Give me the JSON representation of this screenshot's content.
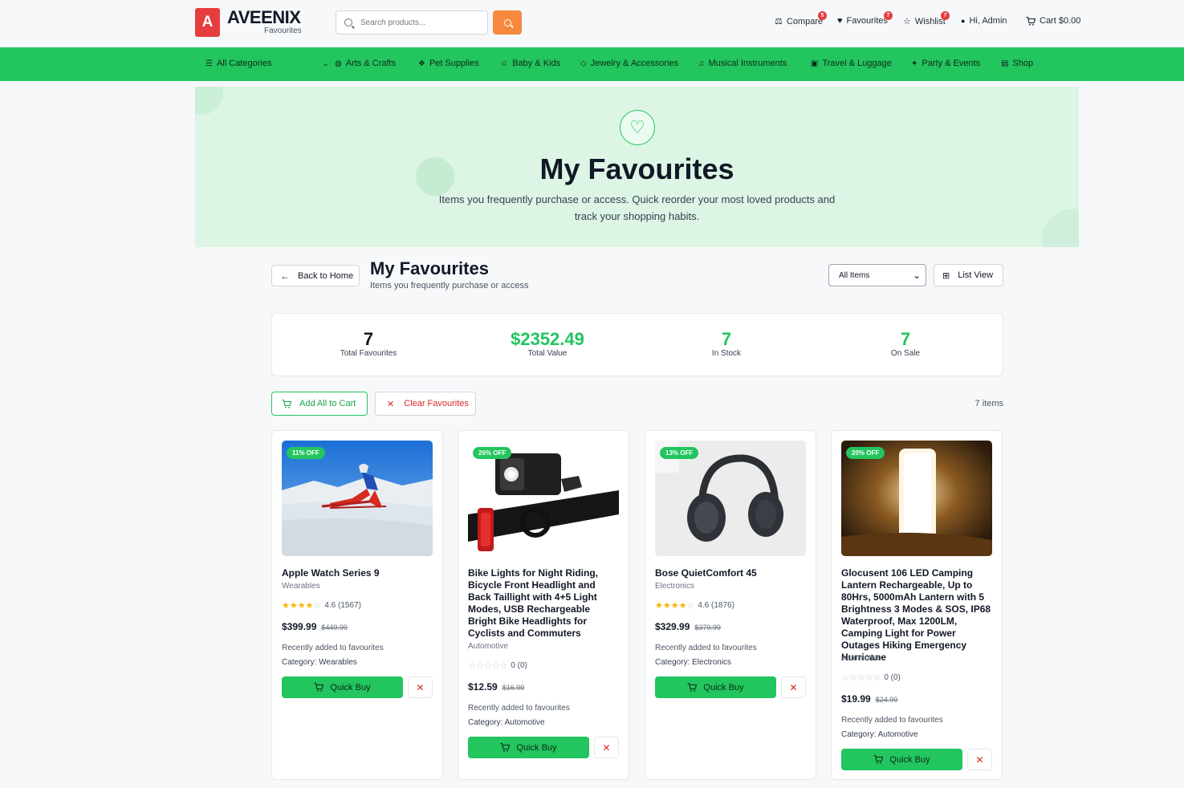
{
  "brand": {
    "name": "AVEENIX",
    "subtitle": "Favourites",
    "logo_letter": "A",
    "logo_color": "#e53e3e"
  },
  "search": {
    "placeholder": "Search products..."
  },
  "header_nav": {
    "compare": {
      "label": "Compare",
      "badge": "5"
    },
    "favourites": {
      "label": "Favourites",
      "badge": "7"
    },
    "wishlist": {
      "label": "Wishlist",
      "badge": "7"
    },
    "account": {
      "label": "Hi, Admin"
    },
    "cart": {
      "label": "Cart $0.00"
    }
  },
  "categories": {
    "all": "All Categories",
    "items": [
      "Arts & Crafts",
      "Pet Supplies",
      "Baby & Kids",
      "Jewelry & Accessories",
      "Musical Instruments",
      "Travel & Luggage",
      "Party & Events",
      "Shop"
    ]
  },
  "hero": {
    "title": "My Favourites",
    "subtitle": "Items you frequently purchase or access. Quick reorder your most loved products and track your shopping habits."
  },
  "page": {
    "back_label": "Back to Home",
    "title": "My Favourites",
    "subtitle": "Items you frequently purchase or access",
    "filter_value": "All Items",
    "filter_options": [
      "All Items"
    ],
    "view_label": "List View"
  },
  "stats": [
    {
      "value": "7",
      "label": "Total Favourites",
      "color": "#111827"
    },
    {
      "value": "$2352.49",
      "label": "Total Value",
      "color": "#22c55e"
    },
    {
      "value": "7",
      "label": "In Stock",
      "color": "#22c55e"
    },
    {
      "value": "7",
      "label": "On Sale",
      "color": "#22c55e"
    }
  ],
  "actions": {
    "add_all": "Add All to Cart",
    "clear": "Clear Favourites",
    "count": "7 items"
  },
  "products": [
    {
      "discount": "11% OFF",
      "name": "Apple Watch Series 9",
      "category": "Wearables",
      "rating": "4.6 (1567)",
      "stars": 4.5,
      "price": "$399.99",
      "old_price": "$449.99",
      "note": "Recently added to favourites",
      "category_line": "Category: Wearables",
      "buy_label": "Quick Buy"
    },
    {
      "discount": "26% OFF",
      "name": "Bike Lights for Night Riding, Bicycle Front Headlight and Back Taillight with 4+5 Light Modes, USB Rechargeable Bright Bike Headlights for Cyclists and Commuters",
      "category": "Automotive",
      "rating": "0 (0)",
      "stars": 0,
      "price": "$12.59",
      "old_price": "$16.99",
      "note": "Recently added to favourites",
      "category_line": "Category: Automotive",
      "buy_label": "Quick Buy"
    },
    {
      "discount": "13% OFF",
      "name": "Bose QuietComfort 45",
      "category": "Electronics",
      "rating": "4.6 (1876)",
      "stars": 4.5,
      "price": "$329.99",
      "old_price": "$379.99",
      "note": "Recently added to favourites",
      "category_line": "Category: Electronics",
      "buy_label": "Quick Buy"
    },
    {
      "discount": "20% OFF",
      "name": "Glocusent 106 LED Camping Lantern Rechargeable, Up to 80Hrs, 5000mAh Lantern with 5 Brightness 3 Modes & SOS, IP68 Waterproof, Max 1200LM, Camping Light for Power Outages Hiking Emergency Hurricane",
      "category": "Automotive",
      "rating": "0 (0)",
      "stars": 0,
      "price": "$19.99",
      "old_price": "$24.99",
      "note": "Recently added to favourites",
      "category_line": "Category: Automotive",
      "buy_label": "Quick Buy"
    }
  ],
  "colors": {
    "accent": "#22c55e",
    "search_button": "#f6893d",
    "danger": "#dc2626"
  }
}
